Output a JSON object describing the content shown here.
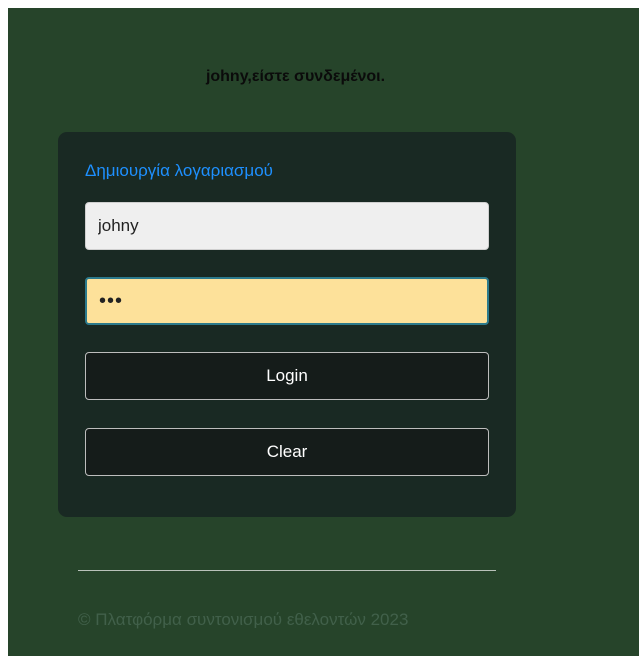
{
  "status": {
    "message": "johny,είστε συνδεμένοι."
  },
  "login_form": {
    "create_account_link": "Δημιουργία λογαριασμού",
    "username_value": "johny",
    "password_mask": "•••",
    "login_button": "Login",
    "clear_button": "Clear"
  },
  "footer": {
    "copyright": "© Πλατφόρμα συντονισμού εθελοντών 2023"
  },
  "colors": {
    "page_background": "#26442a",
    "card_background": "#192923",
    "link": "#1e90ff",
    "password_autofill": "#fde19a"
  }
}
